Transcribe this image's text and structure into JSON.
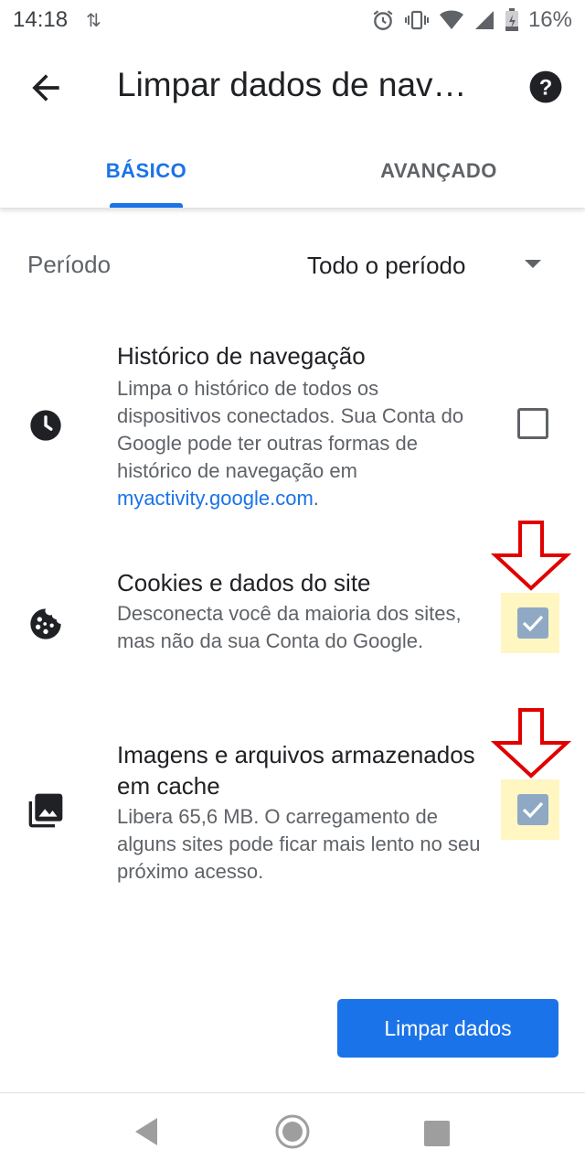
{
  "status": {
    "time": "14:18",
    "sync_glyph": "⇅",
    "battery_percent": "16%",
    "icons": [
      "alarm-icon",
      "vibrate-icon",
      "wifi-icon",
      "signal-icon",
      "battery-icon"
    ]
  },
  "header": {
    "title": "Limpar dados de nav…",
    "back_icon": "arrow-back-icon",
    "help_icon": "help-icon"
  },
  "tabs": [
    {
      "label": "BÁSICO",
      "selected": true
    },
    {
      "label": "AVANÇADO",
      "selected": false
    }
  ],
  "period": {
    "label": "Período",
    "value": "Todo o período"
  },
  "items": [
    {
      "icon": "clock-icon",
      "title": "Histórico de navegação",
      "description": "Limpa o histórico de todos os dispositivos conectados. Sua Conta do Google pode ter outras formas de histórico de navegação em",
      "link": "myactivity.google.com",
      "link_suffix": ".",
      "checked": false
    },
    {
      "icon": "cookie-icon",
      "title": "Cookies e dados do site",
      "description": "Desconecta você da maioria dos sites, mas não da sua Conta do Google.",
      "checked": true
    },
    {
      "icon": "image-stack-icon",
      "title": "Imagens e arquivos armazenados em cache",
      "description": "Libera 65,6 MB. O carregamento de alguns sites pode ficar mais lento no seu próximo acesso.",
      "checked": true
    }
  ],
  "actions": {
    "clear_label": "Limpar dados"
  },
  "colors": {
    "accent": "#1a73e8",
    "callout_arrow": "#e00000",
    "highlight": "#fff6c2",
    "checkbox_checked": "#8fa9c4"
  }
}
